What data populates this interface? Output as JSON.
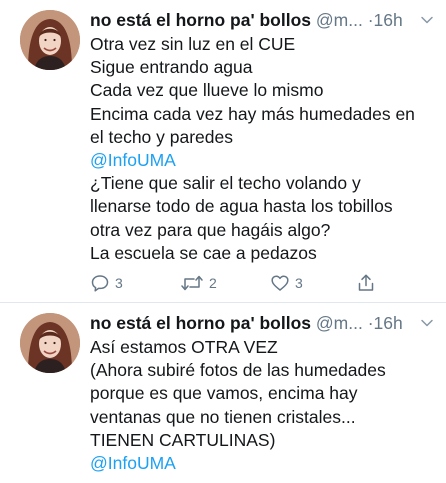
{
  "tweets": [
    {
      "author": {
        "name": "no está el horno pa' bollos",
        "handle": "@m...",
        "separator": "·",
        "time": "16h"
      },
      "lines": [
        "Otra vez sin luz en el CUE",
        "Sigue entrando agua",
        "Cada vez que llueve lo mismo",
        "Encima cada vez hay más humedades en",
        "el techo y paredes",
        "@InfoUMA",
        "¿Tiene que salir el techo volando y",
        "llenarse todo de agua hasta los tobillos",
        "otra vez para que hagáis algo?",
        "La escuela se cae a pedazos"
      ],
      "actions": {
        "replies": "3",
        "retweets": "2",
        "likes": "3"
      }
    },
    {
      "author": {
        "name": "no está el horno pa' bollos",
        "handle": "@m...",
        "separator": "·",
        "time": "16h"
      },
      "lines": [
        "Así estamos OTRA VEZ",
        "(Ahora subiré fotos de las humedades",
        "porque es que vamos, encima hay",
        "ventanas que no tienen cristales...",
        "TIENEN CARTULINAS)",
        "@InfoUMA"
      ]
    }
  ],
  "icons": {
    "reply": "speech-bubble",
    "retweet": "retweet-arrows",
    "like": "heart-outline",
    "share": "share-arrow-up",
    "menu": "chevron-down"
  },
  "colors": {
    "text": "#14171a",
    "muted": "#657786",
    "link": "#1da1f2",
    "divider": "#e1e8ed"
  }
}
